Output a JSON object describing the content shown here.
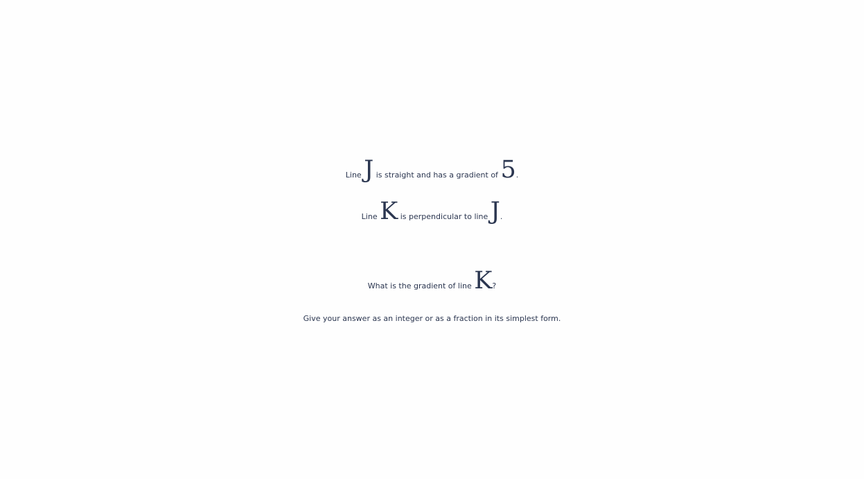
{
  "question": {
    "line1": {
      "pre": "Line ",
      "var": "J",
      "mid": " is straight and has a gradient of ",
      "num": "5",
      "post": "."
    },
    "line2": {
      "pre": "Line ",
      "var1": "K",
      "mid": " is perpendicular to line ",
      "var2": "J",
      "post": "."
    },
    "line3": {
      "pre": "What is the gradient of line ",
      "var": "K",
      "post": "?"
    },
    "line4": "Give your answer as an integer or as a fraction in its simplest form."
  }
}
